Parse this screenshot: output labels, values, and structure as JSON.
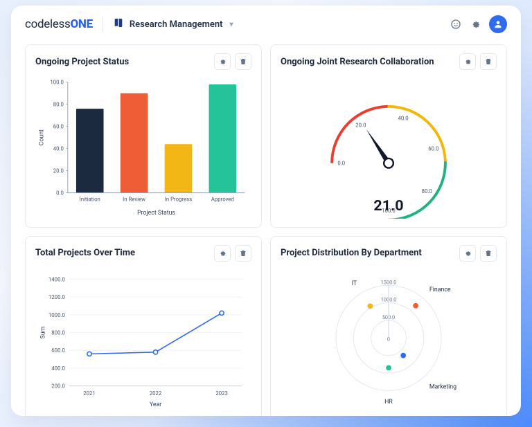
{
  "header": {
    "logo_prefix": "codeless",
    "logo_suffix": "ONE",
    "workspace_label": "Research Management"
  },
  "cards": {
    "project_status": {
      "title": "Ongoing Project Status",
      "xlabel": "Project Status",
      "ylabel": "Count"
    },
    "collaboration": {
      "title": "Ongoing Joint Research Collaboration",
      "value_display": "21.0"
    },
    "over_time": {
      "title": "Total Projects Over Time",
      "xlabel": "Year",
      "ylabel": "Sum"
    },
    "distribution": {
      "title": "Project Distribution By Department"
    }
  },
  "chart_data": [
    {
      "id": "project_status",
      "type": "bar",
      "categories": [
        "Initiation",
        "In Review",
        "In Progress",
        "Approved"
      ],
      "values": [
        76,
        90,
        44,
        98
      ],
      "colors": [
        "#1b2a3e",
        "#ef5d36",
        "#f2b714",
        "#24c39a"
      ],
      "ylim": [
        0,
        100
      ],
      "yticks": [
        0,
        20,
        40,
        60,
        80,
        100
      ],
      "xlabel": "Project Status",
      "ylabel": "Count"
    },
    {
      "id": "collaboration",
      "type": "gauge",
      "value": 21.0,
      "min": 0,
      "max": 100,
      "ticks": [
        0,
        20,
        40,
        60,
        80,
        100
      ],
      "segments": [
        {
          "from": 0,
          "to": 33,
          "color": "#ea3d2f"
        },
        {
          "from": 33,
          "to": 66,
          "color": "#f5b60a"
        },
        {
          "from": 66,
          "to": 100,
          "color": "#1fb37d"
        }
      ]
    },
    {
      "id": "over_time",
      "type": "line",
      "x": [
        2021,
        2022,
        2023
      ],
      "values": [
        560,
        580,
        1020
      ],
      "ylim": [
        200,
        1400
      ],
      "yticks": [
        200,
        400,
        600,
        800,
        1000,
        1200,
        1400
      ],
      "xlabel": "Year",
      "ylabel": "Sum",
      "color": "#2e6bf0"
    },
    {
      "id": "distribution",
      "type": "polar",
      "categories": [
        "IT",
        "Finance",
        "Marketing",
        "HR"
      ],
      "values": [
        1050,
        1200,
        650,
        850
      ],
      "colors": [
        "#f2b714",
        "#ef5d36",
        "#2e6bf0",
        "#24c39a"
      ],
      "rticks": [
        0,
        500,
        1000,
        1500
      ]
    }
  ]
}
